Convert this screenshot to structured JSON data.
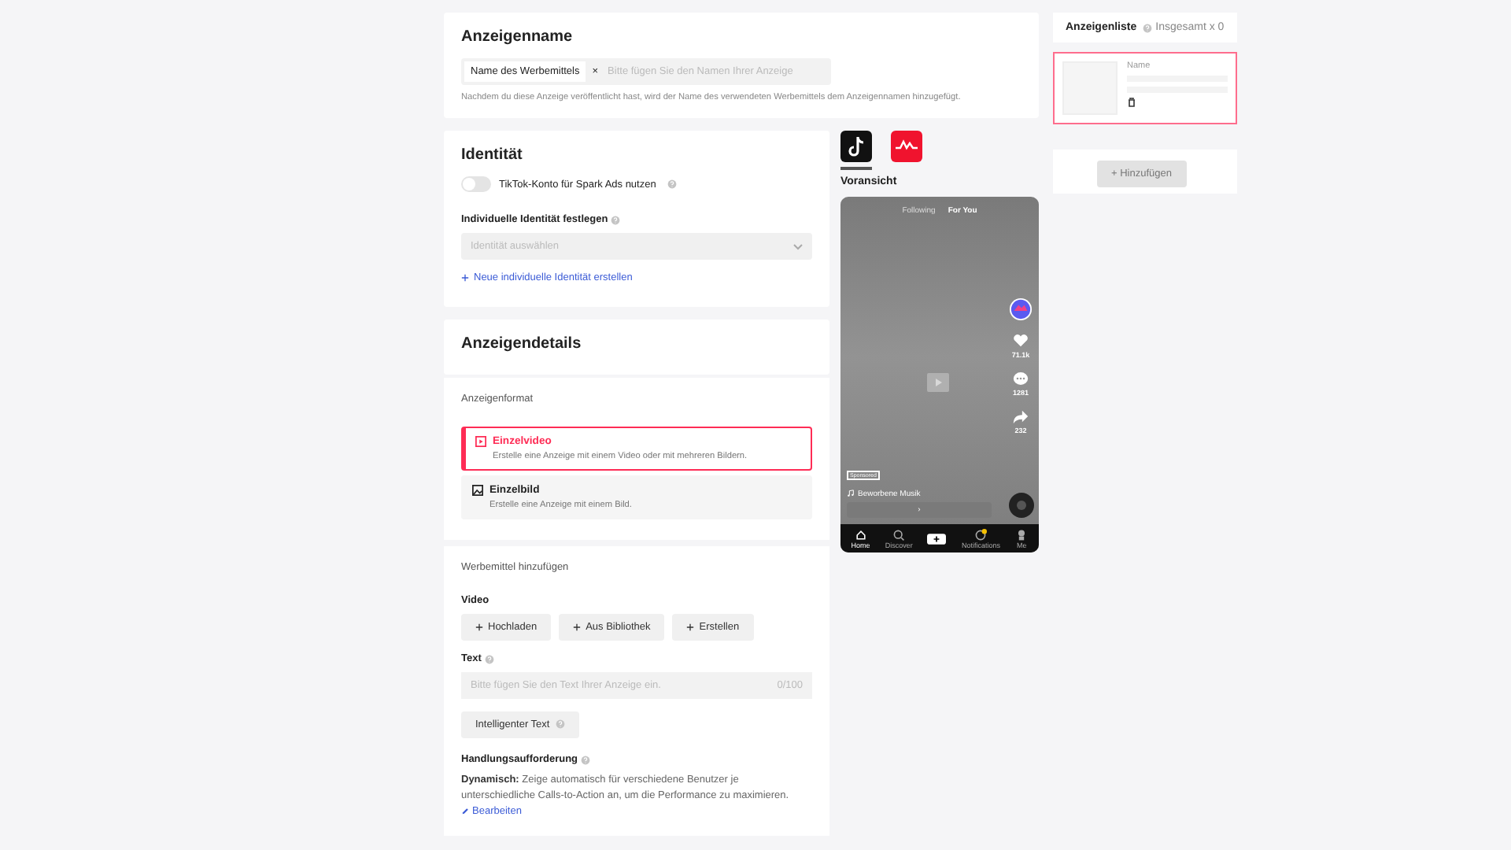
{
  "ad_name": {
    "title": "Anzeigenname",
    "tag": "Name des Werbemittels",
    "tag_remove": "×",
    "placeholder": "Bitte fügen Sie den Namen Ihrer Anzeige",
    "hint": "Nachdem du diese Anzeige veröffentlicht hast, wird der Name des verwendeten Werbemittels dem Anzeigennamen hinzugefügt."
  },
  "identity": {
    "title": "Identität",
    "spark_ads": {
      "label": "TikTok-Konto für Spark Ads nutzen",
      "on": false
    },
    "custom_label": "Individuelle Identität festlegen",
    "select_placeholder": "Identität auswählen",
    "create_link": "Neue individuelle Identität erstellen"
  },
  "ad_details": {
    "title": "Anzeigendetails",
    "format_label": "Anzeigenformat",
    "formats": [
      {
        "kind": "video",
        "title": "Einzelvideo",
        "desc": "Erstelle eine Anzeige mit einem Video oder mit mehreren Bildern.",
        "selected": true
      },
      {
        "kind": "image",
        "title": "Einzelbild",
        "desc": "Erstelle eine Anzeige mit einem Bild.",
        "selected": false
      }
    ],
    "creative_label": "Werbemittel hinzufügen",
    "video_label": "Video",
    "video_buttons": [
      "Hochladen",
      "Aus Bibliothek",
      "Erstellen"
    ],
    "text_label": "Text",
    "text_placeholder": "Bitte fügen Sie den Text Ihrer Anzeige ein.",
    "text_count": "0/100",
    "smart_text": "Intelligenter Text",
    "cta_label": "Handlungsaufforderung",
    "cta_bold": "Dynamisch:",
    "cta_text": "Zeige automatisch für verschiedene Benutzer je unterschiedliche Calls-to-Action an, um die Performance zu maximieren.",
    "cta_edit": "Bearbeiten"
  },
  "preview": {
    "platforms": [
      {
        "kind": "tiktok",
        "selected": true
      },
      {
        "kind": "pangle",
        "selected": false
      }
    ],
    "label": "Voransicht",
    "feed_tabs": [
      {
        "label": "Following",
        "selected": false
      },
      {
        "label": "For You",
        "selected": true
      }
    ],
    "counts": [
      "71.1k",
      "1281",
      "232"
    ],
    "sponsored": "Sponsored",
    "music": "Beworbene Musik",
    "cta": "›",
    "nav": [
      {
        "kind": "home",
        "label": "Home",
        "selected": true
      },
      {
        "kind": "discover",
        "label": "Discover",
        "selected": false
      },
      {
        "kind": "inbox",
        "label": "Notifications",
        "selected": false
      },
      {
        "kind": "me",
        "label": "Me",
        "selected": false
      }
    ]
  },
  "ad_list": {
    "title": "Anzeigenliste",
    "total": "Insgesamt x 0",
    "items": [
      {
        "name_label": "Name",
        "selected": true
      }
    ],
    "add_button": "+ Hinzufügen",
    "add_disabled": true
  }
}
